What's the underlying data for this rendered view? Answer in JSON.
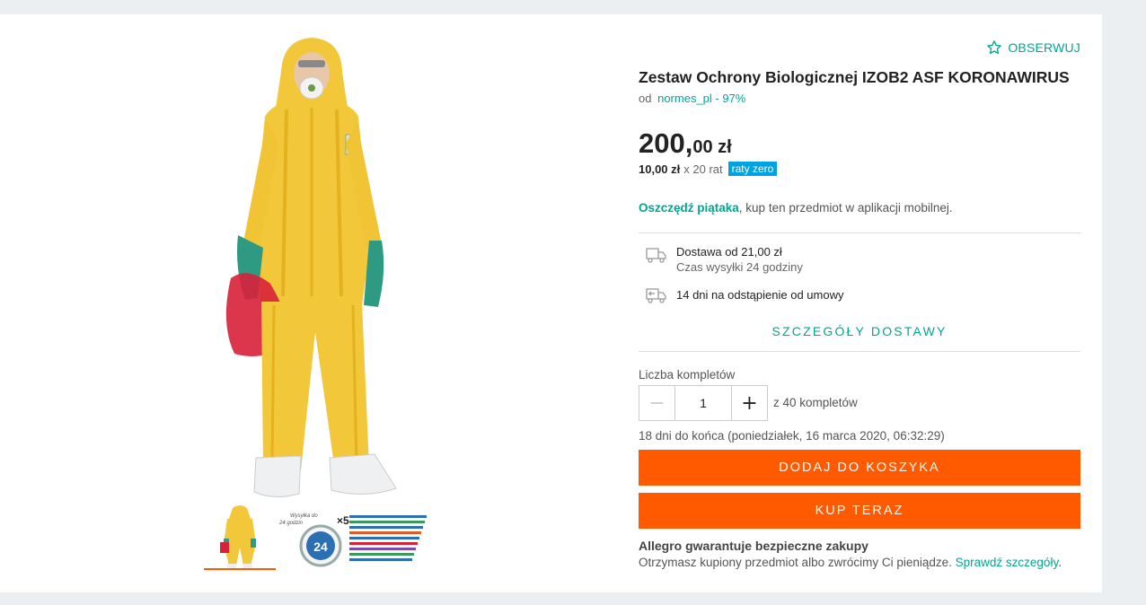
{
  "watch": {
    "label": "OBSERWUJ",
    "icon": "star-outline-icon"
  },
  "product": {
    "title": "Zestaw Ochrony Biologicznej IZOB2 ASF KORONAWIRUS",
    "seller_prefix": "od",
    "seller": "normes_pl - 97%"
  },
  "price": {
    "main": "200,",
    "fraction": "00 zł",
    "installment_amount": "10,00 zł",
    "installment_count": "x 20 rat",
    "installment_badge": "raty zero"
  },
  "promo": {
    "highlight": "Oszczędź piątaka",
    "text": ", kup ten przedmiot w aplikacji mobilnej."
  },
  "delivery": {
    "cost": "Dostawa od 21,00 zł",
    "time": "Czas wysyłki 24 godziny",
    "returns": "14 dni na odstąpienie od umowy",
    "details_link": "SZCZEGÓŁY DOSTAWY"
  },
  "quantity": {
    "label": "Liczba kompletów",
    "value": "1",
    "max": "z 40 kompletów"
  },
  "ending": "18 dni do końca (poniedziałek, 16 marca 2020, 06:32:29)",
  "buttons": {
    "add_to_cart": "DODAJ DO KOSZYKA",
    "buy_now": "KUP TERAZ"
  },
  "guarantee": {
    "title": "Allegro gwarantuje bezpieczne zakupy",
    "text": "Otrzymasz kupiony przedmiot albo zwrócimy Ci pieniądze. ",
    "link": "Sprawdź szczegóły",
    "end": "."
  },
  "thumb_badge": {
    "line1": "Wysyłka do",
    "line2": "24 godzin",
    "number": "24",
    "multiplier": "×5"
  },
  "colors": {
    "accent": "#00a790",
    "cta": "#ff5a00",
    "badge": "#00a2e0",
    "suit": "#f2c73a"
  }
}
